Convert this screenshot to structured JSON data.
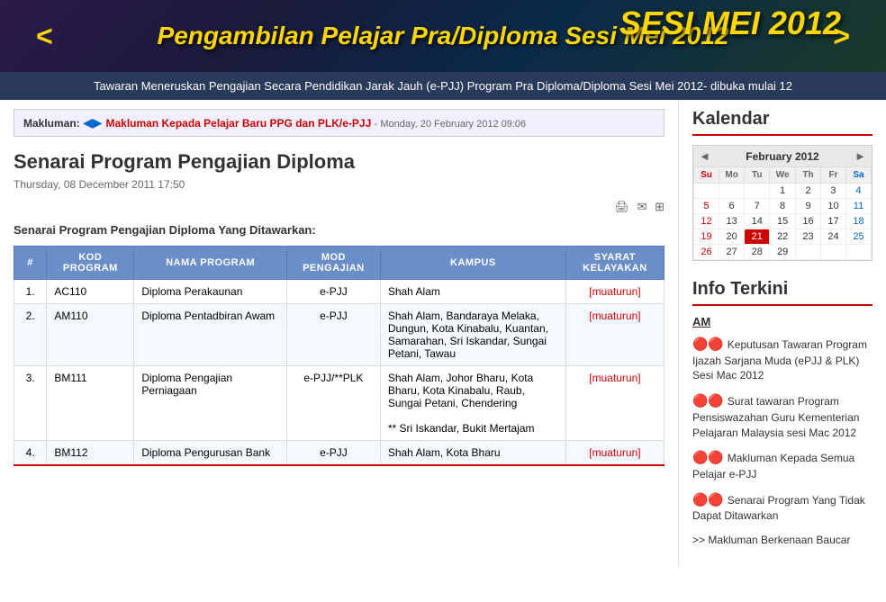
{
  "header": {
    "nav_left": "<",
    "nav_right": ">",
    "title": "Pengambilan Pelajar Pra/Diploma Sesi Mei 2012",
    "sesi_text": "SESI MEI 2012",
    "subbanner": "Tawaran Meneruskan Pengajian Secara Pendidikan Jarak Jauh (e-PJJ) Program Pra Diploma/Diploma Sesi Mei 2012- dibuka mulai 12"
  },
  "notice": {
    "label": "Makluman:",
    "link_text": "Makluman Kepada Pelajar Baru PPG dan PLK/e-PJJ",
    "time": "- Monday, 20 February 2012 09:06"
  },
  "article": {
    "title": "Senarai Program Pengajian Diploma",
    "date": "Thursday, 08 December 2011 17:50",
    "section_label": "Senarai Program Pengajian Diploma Yang Ditawarkan:"
  },
  "table": {
    "headers": [
      "#",
      "KOD PROGRAM",
      "NAMA PROGRAM",
      "MOD PENGAJIAN",
      "KAMPUS",
      "SYARAT KELAYAKAN"
    ],
    "rows": [
      {
        "num": "1.",
        "kod": "AC110",
        "nama": "Diploma Perakaunan",
        "mod": "e-PJJ",
        "kampus": "Shah Alam",
        "syarat": "[muaturun]"
      },
      {
        "num": "2.",
        "kod": "AM110",
        "nama": "Diploma Pentadbiran Awam",
        "mod": "e-PJJ",
        "kampus": "Shah Alam, Bandaraya Melaka, Dungun, Kota Kinabalu, Kuantan, Samarahan, Sri Iskandar, Sungai Petani, Tawau",
        "syarat": "[muaturun]"
      },
      {
        "num": "3.",
        "kod": "BM111",
        "nama": "Diploma Pengajian Perniagaan",
        "mod": "e-PJJ/**PLK",
        "kampus": "Shah Alam, Johor Bharu, Kota Bharu, Kota Kinabalu, Raub, Sungai Petani, Chendering\n\n** Sri Iskandar, Bukit Mertajam",
        "syarat": "[muaturun]"
      },
      {
        "num": "4.",
        "kod": "BM112",
        "nama": "Diploma Pengurusan Bank",
        "mod": "e-PJJ",
        "kampus": "Shah Alam, Kota Bharu",
        "syarat": "[muaturun]"
      }
    ]
  },
  "sidebar": {
    "calendar_title": "Kalendar",
    "calendar_month": "February 2012",
    "cal_nav_left": "◄",
    "cal_nav_right": "►",
    "days_header": [
      "Su",
      "Mo",
      "Tu",
      "We",
      "Th",
      "Fr",
      "Sa"
    ],
    "weeks": [
      [
        "",
        "",
        "",
        "1",
        "2",
        "3",
        "4"
      ],
      [
        "5",
        "6",
        "7",
        "8",
        "9",
        "10",
        "11"
      ],
      [
        "12",
        "13",
        "14",
        "15",
        "16",
        "17",
        "18"
      ],
      [
        "19",
        "20",
        "21",
        "22",
        "23",
        "24",
        "25"
      ],
      [
        "26",
        "27",
        "28",
        "29",
        "",
        "",
        ""
      ]
    ],
    "today": "21",
    "info_title": "Info Terkini",
    "info_section": "AM",
    "info_items": [
      "Keputusan Tawaran Program Ijazah Sarjana Muda (ePJJ & PLK) Sesi Mac 2012",
      "Surat tawaran Program Pensiswazahan Guru Kementerian Pelajaran  Malaysia sesi Mac 2012",
      "Makluman Kepada Semua Pelajar e-PJJ",
      "Senarai Program Yang Tidak Dapat Ditawarkan"
    ],
    "info_link": ">> Makluman Berkenaan Baucar"
  }
}
